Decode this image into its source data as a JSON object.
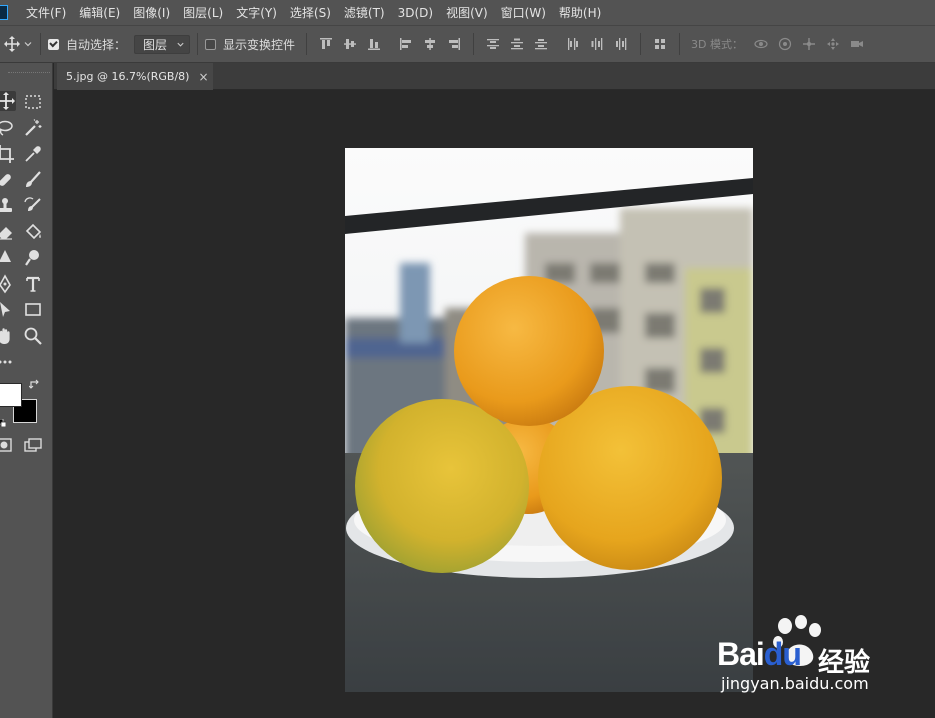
{
  "app": {
    "menu": [
      "文件(F)",
      "编辑(E)",
      "图像(I)",
      "图层(L)",
      "文字(Y)",
      "选择(S)",
      "滤镜(T)",
      "3D(D)",
      "视图(V)",
      "窗口(W)",
      "帮助(H)"
    ]
  },
  "options": {
    "auto_select_label": "自动选择：",
    "auto_select_checked": true,
    "layer_select_value": "图层",
    "transform_controls_label": "显示变换控件",
    "transform_controls_checked": false,
    "threed_label": "3D 模式："
  },
  "document": {
    "tab_title": "5.jpg @ 16.7%(RGB/8)",
    "tab_close": "×"
  },
  "colors": {
    "foreground": "#ffffff",
    "background": "#000000",
    "panel": "#535353",
    "workspace": "#282828"
  },
  "watermark": {
    "brand": "Bai",
    "brand_suffix": "du",
    "product": "经验",
    "url": "jingyan.baidu.com"
  }
}
